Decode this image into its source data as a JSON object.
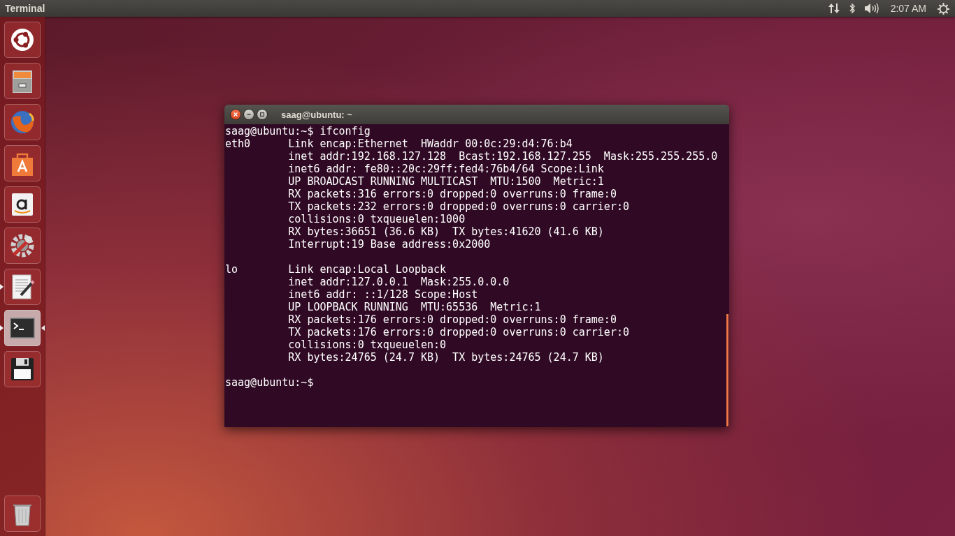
{
  "top_panel": {
    "title": "Terminal",
    "clock": "2:07 AM"
  },
  "launcher": {
    "items": [
      {
        "kind": "dash",
        "running": false,
        "focused": false
      },
      {
        "kind": "files",
        "running": false,
        "focused": false
      },
      {
        "kind": "browser",
        "running": false,
        "focused": false
      },
      {
        "kind": "store",
        "running": false,
        "focused": false
      },
      {
        "kind": "amazon",
        "running": false,
        "focused": false
      },
      {
        "kind": "settings",
        "running": false,
        "focused": false
      },
      {
        "kind": "editor",
        "running": true,
        "focused": false
      },
      {
        "kind": "terminal",
        "running": true,
        "focused": true
      },
      {
        "kind": "disk",
        "running": false,
        "focused": false
      }
    ],
    "trash": {
      "kind": "trash"
    }
  },
  "window": {
    "title": "saag@ubuntu: ~",
    "blocks": [
      [
        "saag@ubuntu:~$ ifconfig",
        "eth0      Link encap:Ethernet  HWaddr 00:0c:29:d4:76:b4",
        "          inet addr:192.168.127.128  Bcast:192.168.127.255  Mask:255.255.255.0",
        "          inet6 addr: fe80::20c:29ff:fed4:76b4/64 Scope:Link",
        "          UP BROADCAST RUNNING MULTICAST  MTU:1500  Metric:1",
        "          RX packets:316 errors:0 dropped:0 overruns:0 frame:0",
        "          TX packets:232 errors:0 dropped:0 overruns:0 carrier:0",
        "          collisions:0 txqueuelen:1000",
        "          RX bytes:36651 (36.6 KB)  TX bytes:41620 (41.6 KB)",
        "          Interrupt:19 Base address:0x2000"
      ],
      [
        "lo        Link encap:Local Loopback",
        "          inet addr:127.0.0.1  Mask:255.0.0.0",
        "          inet6 addr: ::1/128 Scope:Host",
        "          UP LOOPBACK RUNNING  MTU:65536  Metric:1",
        "          RX packets:176 errors:0 dropped:0 overruns:0 frame:0",
        "          TX packets:176 errors:0 dropped:0 overruns:0 carrier:0",
        "          collisions:0 txqueuelen:0",
        "          RX bytes:24765 (24.7 KB)  TX bytes:24765 (24.7 KB)"
      ],
      [
        "saag@ubuntu:~$"
      ]
    ]
  }
}
